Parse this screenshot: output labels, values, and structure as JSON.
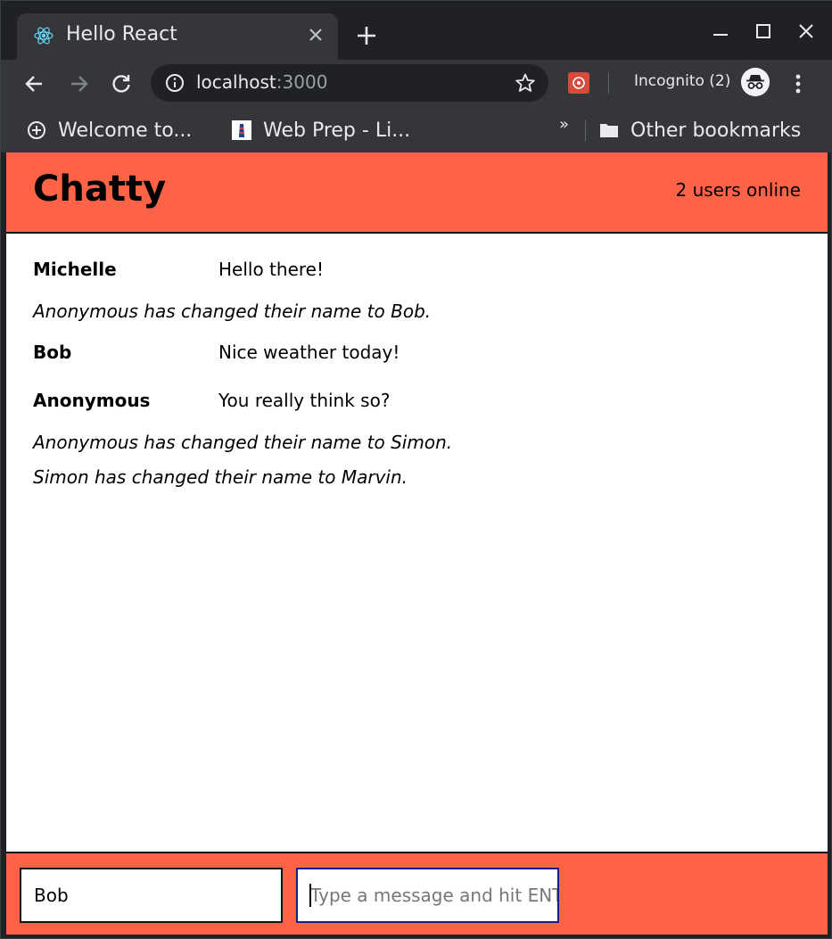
{
  "browser": {
    "tab_title": "Hello React",
    "url_host": "localhost",
    "url_port": ":3000",
    "incognito_label": "Incognito (2)",
    "bookmarks": [
      {
        "label": "Welcome to..."
      },
      {
        "label": "Web Prep - Li..."
      }
    ],
    "bookmarks_more": "»",
    "other_bookmarks": "Other bookmarks"
  },
  "app": {
    "brand": "Chatty",
    "users_online": "2 users online",
    "accent_color": "#ff6347",
    "messages": [
      {
        "type": "message",
        "username": "Michelle",
        "content": "Hello there!"
      },
      {
        "type": "notification",
        "content": "Anonymous has changed their name to Bob."
      },
      {
        "type": "message",
        "username": "Bob",
        "content": "Nice weather today!"
      },
      {
        "type": "message",
        "username": "Anonymous",
        "content": "You really think so?"
      },
      {
        "type": "notification",
        "content": "Anonymous has changed their name to Simon."
      },
      {
        "type": "notification",
        "content": "Simon has changed their name to Marvin."
      }
    ],
    "chatbar": {
      "username_value": "Bob",
      "message_placeholder": "Type a message and hit ENTER"
    }
  }
}
